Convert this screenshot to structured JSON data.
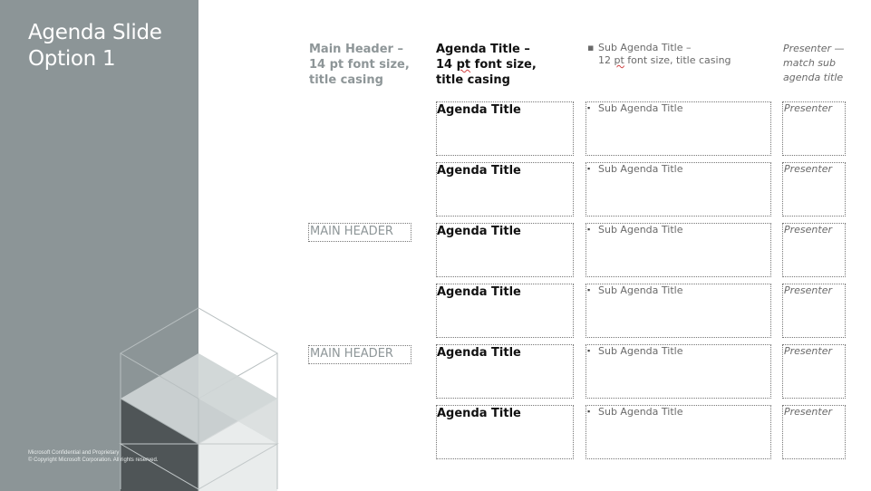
{
  "slide": {
    "title_line1": "Agenda Slide",
    "title_line2": "Option 1",
    "footer_line1": "Microsoft Confidential and Proprietary",
    "footer_line2": "© Copyright Microsoft Corporation. All rights reserved."
  },
  "column_headers": {
    "main_header_line1": "Main Header –",
    "main_header_line2": "14 pt font size,",
    "main_header_line3": "title casing",
    "agenda_title_line1": "Agenda Title –",
    "agenda_title_line2_pt": "pt",
    "agenda_title_line2_prefix": "14 ",
    "agenda_title_line2_suffix": " font size,",
    "agenda_title_line3": "title casing",
    "sub_agenda_bullet": "▪",
    "sub_agenda_line1": "Sub Agenda Title –",
    "sub_agenda_line2_prefix": "12 ",
    "sub_agenda_line2_pt": "pt",
    "sub_agenda_line2_suffix": " font size, title casing",
    "presenter_line1": "Presenter —",
    "presenter_line2": "match sub",
    "presenter_line3": "agenda title"
  },
  "main_headers": [
    {
      "label": "MAIN HEADER"
    },
    {
      "label": "MAIN HEADER"
    }
  ],
  "rows": [
    {
      "agenda": "Agenda Title",
      "bullet": "▪",
      "sub": "Sub Agenda Title",
      "presenter": "Presenter"
    },
    {
      "agenda": "Agenda Title",
      "bullet": "▪",
      "sub": "Sub Agenda Title",
      "presenter": "Presenter"
    },
    {
      "agenda": "Agenda Title",
      "bullet": "▪",
      "sub": "Sub Agenda Title",
      "presenter": "Presenter"
    },
    {
      "agenda": "Agenda Title",
      "bullet": "▪",
      "sub": "Sub Agenda Title",
      "presenter": "Presenter"
    },
    {
      "agenda": "Agenda Title",
      "bullet": "▪",
      "sub": "Sub Agenda Title",
      "presenter": "Presenter"
    },
    {
      "agenda": "Agenda Title",
      "bullet": "▪",
      "sub": "Sub Agenda Title",
      "presenter": "Presenter"
    }
  ],
  "colors": {
    "sidebar": "#8c9597",
    "header_gray": "#8e9698",
    "text_dark": "#111111",
    "text_muted": "#6a6a6a"
  }
}
